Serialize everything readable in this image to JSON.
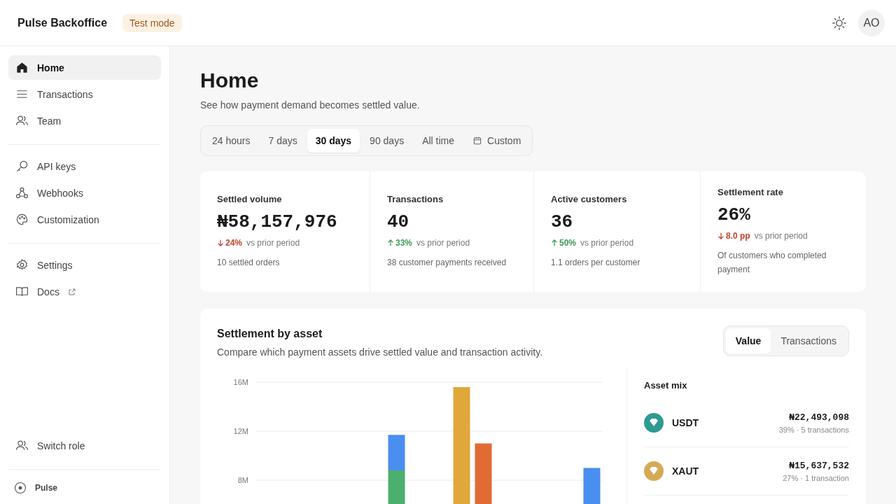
{
  "header": {
    "brand": "Pulse Backoffice",
    "badge": "Test mode",
    "avatar": "AO"
  },
  "sidebar": {
    "groups": [
      [
        {
          "label": "Home",
          "selected": true
        },
        {
          "label": "Transactions",
          "selected": false
        },
        {
          "label": "Team",
          "selected": false
        }
      ],
      [
        {
          "label": "API keys",
          "selected": false
        },
        {
          "label": "Webhooks",
          "selected": false
        },
        {
          "label": "Customization",
          "selected": false
        }
      ],
      [
        {
          "label": "Settings",
          "selected": false
        },
        {
          "label": "Docs",
          "selected": false,
          "external": true
        }
      ]
    ],
    "switch_role": "Switch role",
    "footer": "Pulse"
  },
  "page": {
    "title": "Home",
    "subtitle": "See how payment demand becomes settled value."
  },
  "periods": [
    {
      "label": "24 hours",
      "selected": false,
      "kind": "preset"
    },
    {
      "label": "7 days",
      "selected": false,
      "kind": "preset"
    },
    {
      "label": "30 days",
      "selected": true,
      "kind": "preset"
    },
    {
      "label": "90 days",
      "selected": false,
      "kind": "preset"
    },
    {
      "label": "All time",
      "selected": false,
      "kind": "preset"
    },
    {
      "label": "Custom",
      "selected": false,
      "kind": "date-range"
    }
  ],
  "stats": [
    {
      "title": "Settled volume",
      "value": "₦58,157,976",
      "kind": "down",
      "delta": "24%",
      "compare": "vs prior period",
      "note": "10 settled orders"
    },
    {
      "title": "Transactions",
      "value": "40",
      "kind": "up",
      "delta": "33%",
      "compare": "vs prior period",
      "note": "38 customer payments received"
    },
    {
      "title": "Active customers",
      "value": "36",
      "kind": "up",
      "delta": "50%",
      "compare": "vs prior period",
      "note": "1.1 orders per customer"
    },
    {
      "title": "Settlement rate",
      "value": "26%",
      "kind": "down",
      "delta": "8.0 pp",
      "compare": "vs prior period",
      "note": "Of customers who completed payment"
    }
  ],
  "settlement": {
    "title": "Settlement by asset",
    "subtitle": "Compare which payment assets drive settled value and transaction activity.",
    "toggle": [
      {
        "label": "Value",
        "selected": true
      },
      {
        "label": "Transactions",
        "selected": false
      }
    ],
    "chart_data": {
      "type": "bar",
      "stacked": true,
      "ylim": [
        0,
        16
      ],
      "yticks": [
        {
          "value": 8,
          "label": "8M"
        },
        {
          "value": 12,
          "label": "12M"
        },
        {
          "value": 16,
          "label": "16M"
        }
      ],
      "series": [
        {
          "color": "#4caf6e",
          "values": [
            null,
            null,
            null,
            null,
            null,
            null,
            8.8,
            null,
            null,
            null,
            null,
            null,
            null,
            null,
            null,
            null
          ]
        },
        {
          "color": "#4a8ef0",
          "values": [
            null,
            null,
            null,
            null,
            null,
            null,
            2.9,
            null,
            null,
            null,
            null,
            null,
            null,
            null,
            null,
            9.0
          ]
        },
        {
          "color": "#e0a83a",
          "values": [
            null,
            null,
            null,
            null,
            null,
            null,
            null,
            null,
            null,
            15.6,
            null,
            null,
            null,
            null,
            null,
            null
          ]
        },
        {
          "color": "#e06b35",
          "values": [
            null,
            null,
            null,
            null,
            null,
            null,
            null,
            null,
            null,
            null,
            11.0,
            null,
            null,
            null,
            null,
            null
          ]
        }
      ]
    },
    "mix_title": "Asset mix",
    "assets": [
      {
        "name": "USDT",
        "color": "#2f9a92",
        "value": "₦22,493,098",
        "detail": "39% · 5 transactions"
      },
      {
        "name": "XAUT",
        "color": "#d4aa55",
        "value": "₦15,637,532",
        "detail": "27% · 1 transaction"
      }
    ]
  }
}
